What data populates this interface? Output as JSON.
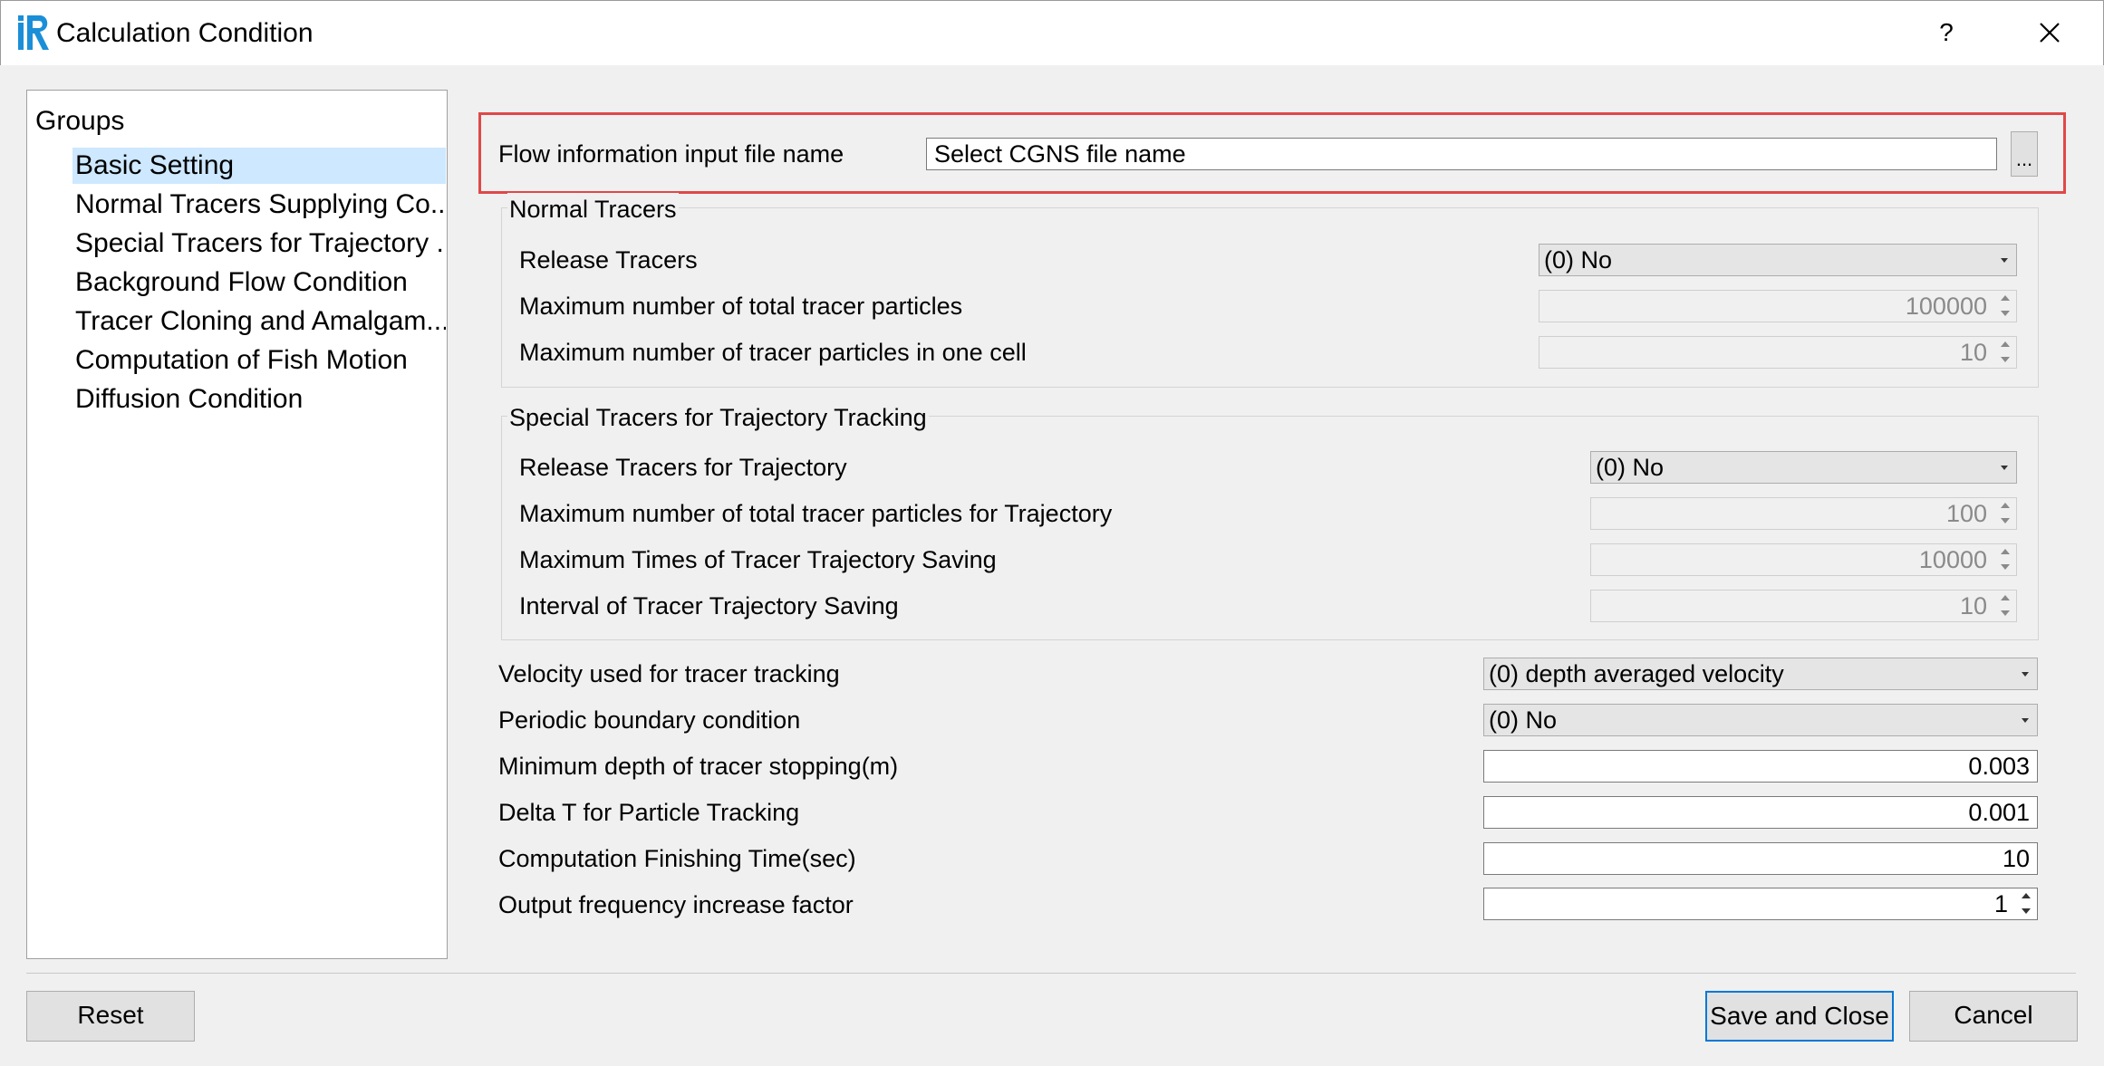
{
  "window": {
    "title": "Calculation Condition",
    "help_label": "?",
    "icon": "iric-app-icon"
  },
  "groups": {
    "header": "Groups",
    "items": [
      "Basic Setting",
      "Normal Tracers Supplying Co...",
      "Special Tracers for Trajectory ...",
      "Background Flow Condition",
      "Tracer Cloning and Amalgam...",
      "Computation of Fish Motion",
      "Diffusion Condition"
    ],
    "selected": "Basic Setting"
  },
  "basic": {
    "flow_file_label": "Flow information input file name",
    "flow_file_value": "Select CGNS file name",
    "browse_label": "...",
    "normal_tracers": {
      "title": "Normal Tracers",
      "release_label": "Release Tracers",
      "release_value": "(0) No",
      "max_total_label": "Maximum number of total tracer particles",
      "max_total_value": "100000",
      "max_cell_label": "Maximum number of tracer particles in one cell",
      "max_cell_value": "10"
    },
    "special_tracers": {
      "title": "Special Tracers for Trajectory Tracking",
      "release_label": "Release Tracers for Trajectory",
      "release_value": "(0) No",
      "max_total_label": "Maximum number of total tracer particles for Trajectory",
      "max_total_value": "100",
      "max_times_label": "Maximum Times of Tracer Trajectory Saving",
      "max_times_value": "10000",
      "interval_label": "Interval of Tracer Trajectory Saving",
      "interval_value": "10"
    },
    "velocity_label": "Velocity used for tracer tracking",
    "velocity_value": "(0) depth averaged velocity",
    "periodic_label": "Periodic boundary condition",
    "periodic_value": "(0) No",
    "min_depth_label": "Minimum depth of tracer stopping(m)",
    "min_depth_value": "0.003",
    "delta_t_label": "Delta T for Particle Tracking",
    "delta_t_value": "0.001",
    "finish_time_label": "Computation Finishing Time(sec)",
    "finish_time_value": "10",
    "output_freq_label": "Output frequency increase factor",
    "output_freq_value": "1"
  },
  "buttons": {
    "reset": "Reset",
    "save_close": "Save and Close",
    "cancel": "Cancel"
  },
  "colors": {
    "highlight": "#e04848",
    "selection": "#cde8ff",
    "default_button_border": "#0078d7"
  }
}
